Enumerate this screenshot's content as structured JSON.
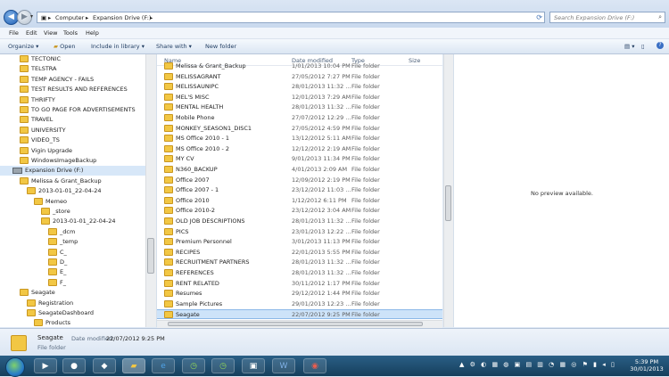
{
  "address": {
    "crumbs": [
      "Computer",
      "Expansion Drive (F:)"
    ],
    "separator": "▸"
  },
  "search": {
    "placeholder": "Search Expansion Drive (F:)"
  },
  "menu": [
    "File",
    "Edit",
    "View",
    "Tools",
    "Help"
  ],
  "toolbar": [
    "Organize ▾",
    "Open",
    "Include in library ▾",
    "Share with ▾",
    "New folder"
  ],
  "columns": {
    "name": "Name",
    "date": "Date modified",
    "type": "Type",
    "size": "Size"
  },
  "nav_items": [
    {
      "label": "TECTONIC",
      "indent": 1,
      "icon": "folder"
    },
    {
      "label": "TELSTRA",
      "indent": 1,
      "icon": "folder"
    },
    {
      "label": "TEMP AGENCY - FAILS",
      "indent": 1,
      "icon": "folder"
    },
    {
      "label": "TEST RESULTS AND REFERENCES",
      "indent": 1,
      "icon": "folder"
    },
    {
      "label": "THRIFTY",
      "indent": 1,
      "icon": "folder"
    },
    {
      "label": "TO GO PAGE FOR ADVERTISEMENTS",
      "indent": 1,
      "icon": "folder"
    },
    {
      "label": "TRAVEL",
      "indent": 1,
      "icon": "folder"
    },
    {
      "label": "UNIVERSITY",
      "indent": 1,
      "icon": "folder"
    },
    {
      "label": "VIDEO_TS",
      "indent": 1,
      "icon": "folder"
    },
    {
      "label": "Vigin Upgrade",
      "indent": 1,
      "icon": "folder"
    },
    {
      "label": "WindowsImageBackup",
      "indent": 1,
      "icon": "folder"
    },
    {
      "label": "Expansion Drive (F:)",
      "indent": 0,
      "icon": "drive",
      "selected": true
    },
    {
      "label": "Melissa & Grant_Backup",
      "indent": 1,
      "icon": "folder"
    },
    {
      "label": "2013-01-01_22-04-24",
      "indent": 2,
      "icon": "folder"
    },
    {
      "label": "Memeo",
      "indent": 3,
      "icon": "folder"
    },
    {
      "label": "_store",
      "indent": 4,
      "icon": "folder"
    },
    {
      "label": "2013-01-01_22-04-24",
      "indent": 4,
      "icon": "folder"
    },
    {
      "label": "_dcm",
      "indent": 5,
      "icon": "folder"
    },
    {
      "label": "_temp",
      "indent": 5,
      "icon": "folder"
    },
    {
      "label": "C_",
      "indent": 5,
      "icon": "folder"
    },
    {
      "label": "D_",
      "indent": 5,
      "icon": "folder"
    },
    {
      "label": "E_",
      "indent": 5,
      "icon": "folder"
    },
    {
      "label": "F_",
      "indent": 5,
      "icon": "folder"
    },
    {
      "label": "Seagate",
      "indent": 1,
      "icon": "folder"
    },
    {
      "label": "Registration",
      "indent": 2,
      "icon": "folder"
    },
    {
      "label": "SeagateDashboard",
      "indent": 2,
      "icon": "folder"
    },
    {
      "label": "Products",
      "indent": 3,
      "icon": "folder"
    }
  ],
  "files": [
    {
      "name": "Melissa & Grant_Backup",
      "date": "1/01/2013 10:04 PM",
      "type": "File folder"
    },
    {
      "name": "MELISSAGRANT",
      "date": "27/05/2012 7:27 PM",
      "type": "File folder"
    },
    {
      "name": "MELISSAUNIPC",
      "date": "28/01/2013 11:32 ...",
      "type": "File folder"
    },
    {
      "name": "MEL'S MISC",
      "date": "12/01/2013 7:29 AM",
      "type": "File folder"
    },
    {
      "name": "MENTAL HEALTH",
      "date": "28/01/2013 11:32 ...",
      "type": "File folder"
    },
    {
      "name": "Mobile Phone",
      "date": "27/07/2012 12:29 ...",
      "type": "File folder"
    },
    {
      "name": "MONKEY_SEASON1_DISC1",
      "date": "27/05/2012 4:59 PM",
      "type": "File folder"
    },
    {
      "name": "MS Office 2010 - 1",
      "date": "13/12/2012 5:11 AM",
      "type": "File folder"
    },
    {
      "name": "MS Office 2010 - 2",
      "date": "12/12/2012 2:19 AM",
      "type": "File folder"
    },
    {
      "name": "MY CV",
      "date": "9/01/2013 11:34 PM",
      "type": "File folder"
    },
    {
      "name": "N360_BACKUP",
      "date": "4/01/2013 2:09 AM",
      "type": "File folder"
    },
    {
      "name": "Office 2007",
      "date": "12/09/2012 2:19 PM",
      "type": "File folder"
    },
    {
      "name": "Office 2007 - 1",
      "date": "23/12/2012 11:03 ...",
      "type": "File folder"
    },
    {
      "name": "Office 2010",
      "date": "1/12/2012 6:11 PM",
      "type": "File folder"
    },
    {
      "name": "Office 2010-2",
      "date": "23/12/2012 3:04 AM",
      "type": "File folder"
    },
    {
      "name": "OLD JOB DESCRIPTIONS",
      "date": "28/01/2013 11:32 ...",
      "type": "File folder"
    },
    {
      "name": "PICS",
      "date": "23/01/2013 12:22 ...",
      "type": "File folder"
    },
    {
      "name": "Premium Personnel",
      "date": "3/01/2013 11:13 PM",
      "type": "File folder"
    },
    {
      "name": "RECIPES",
      "date": "22/01/2013 5:55 PM",
      "type": "File folder"
    },
    {
      "name": "RECRUITMENT PARTNERS",
      "date": "28/01/2013 11:32 ...",
      "type": "File folder"
    },
    {
      "name": "REFERENCES",
      "date": "28/01/2013 11:32 ...",
      "type": "File folder"
    },
    {
      "name": "RENT RELATED",
      "date": "30/11/2012 1:17 PM",
      "type": "File folder"
    },
    {
      "name": "Resumes",
      "date": "29/12/2012 1:44 PM",
      "type": "File folder"
    },
    {
      "name": "Sample Pictures",
      "date": "29/01/2013 12:23 ...",
      "type": "File folder"
    },
    {
      "name": "Seagate",
      "date": "22/07/2012 9:25 PM",
      "type": "File folder",
      "selected": true
    }
  ],
  "preview_text": "No preview available.",
  "details": {
    "name": "Seagate",
    "date_label": "Date modified:",
    "date_value": "22/07/2012 9:25 PM",
    "kind": "File folder"
  },
  "taskbar": {
    "time": "5:39 PM",
    "date": "30/01/2013"
  },
  "colors": {
    "selection": "#cde3f9",
    "folder": "#f2c744",
    "taskbar": "#1f4f72"
  }
}
